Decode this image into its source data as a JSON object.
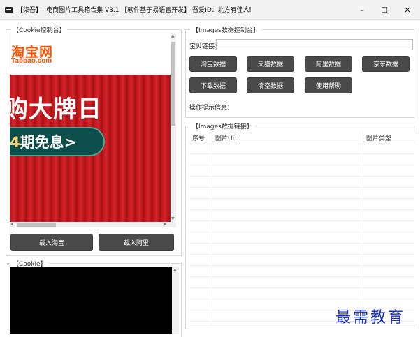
{
  "window": {
    "title": "【柒吾】- 电商图片工具箱合集 V3.1     【软件基于易语言开发】    吾爱ID：北方有佳人i",
    "minimize_glyph": "–",
    "maximize_glyph": "☐",
    "close_glyph": "✕"
  },
  "cookie_console": {
    "legend": "【Cookie控制台】",
    "taobao_logo_cn": "淘宝网",
    "taobao_logo_en": "Taobao.com",
    "banner_line1": "购大牌日",
    "banner_line2_num": "4",
    "banner_line2_text": "期免息>",
    "load_taobao": "载入淘宝",
    "load_ali": "载入阿里"
  },
  "cookie": {
    "legend": "【Cookie】"
  },
  "images_console": {
    "legend": "【Images数据控制台】",
    "link_label": "宝贝链接：",
    "link_value": "",
    "buttons": {
      "taobao": "淘宝数据",
      "tmall": "天猫数据",
      "ali": "阿里数据",
      "jd": "京东数据",
      "download": "下载数据",
      "clear": "清空数据",
      "help": "使用帮助"
    },
    "tip_label": "操作提示信息："
  },
  "images_links": {
    "legend": "【Images数据链接】",
    "columns": [
      "序号",
      "图片Url",
      "图片类型"
    ]
  },
  "watermark": "最需教育",
  "colors": {
    "button_bg": "#4a4a4a",
    "banner_red": "#c8181e",
    "logo_orange": "#ff5000",
    "watermark_blue": "#1a2ed0"
  }
}
